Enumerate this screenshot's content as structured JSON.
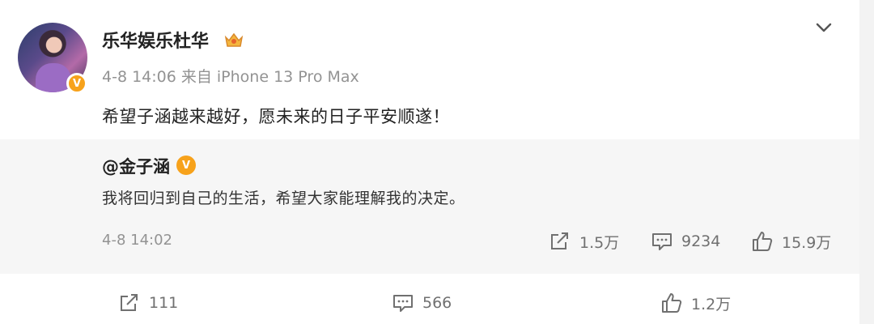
{
  "post": {
    "author": "乐华娱乐杜华",
    "meta": "4-8 14:06 来自 iPhone 13 Pro Max",
    "text": "希望子涵越来越好，愿未来的日子平安顺遂！"
  },
  "repost": {
    "author": "@金子涵",
    "text": "我将回归到自己的生活，希望大家能理解我的决定。",
    "time": "4-8 14:02",
    "reposts": "1.5万",
    "comments": "9234",
    "likes": "15.9万"
  },
  "actions": {
    "reposts": "111",
    "comments": "566",
    "likes": "1.2万"
  },
  "colors": {
    "verified": "#f7a21b",
    "gray_text": "#939393",
    "quote_bg": "#f6f6f6"
  },
  "icons": [
    "chevron-down-icon",
    "crown-badge-icon",
    "verified-badge-icon",
    "repost-icon",
    "comment-icon",
    "like-icon"
  ]
}
